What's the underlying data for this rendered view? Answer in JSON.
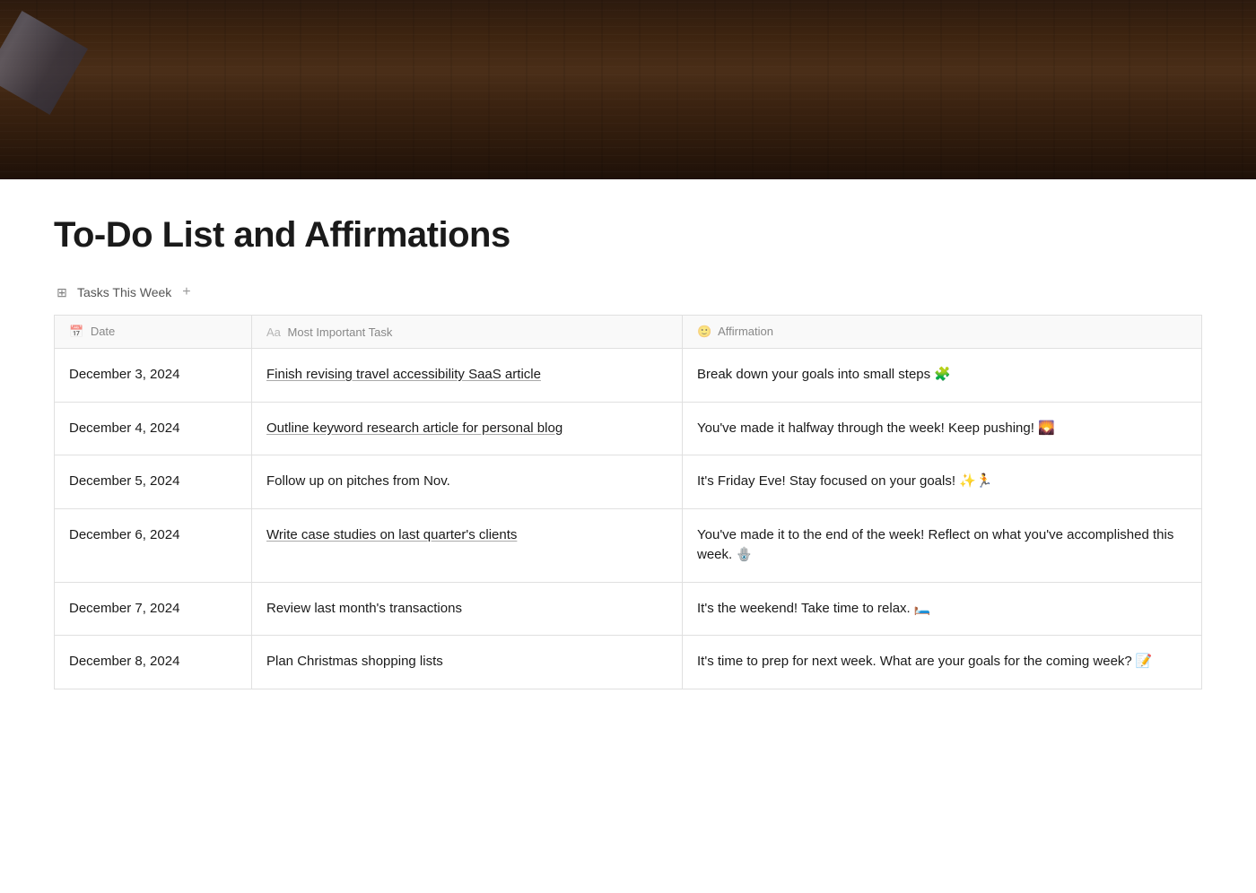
{
  "header": {
    "alt": "Wood texture background"
  },
  "page": {
    "title": "To-Do List and Affirmations"
  },
  "section": {
    "icon": "⊞",
    "label": "Tasks This Week",
    "add_label": "+"
  },
  "table": {
    "columns": [
      {
        "id": "date",
        "icon": "📅",
        "label": "Date"
      },
      {
        "id": "task",
        "icon": "Aa",
        "label": "Most Important Task"
      },
      {
        "id": "affirmation",
        "icon": "🙂",
        "label": "Affirmation"
      }
    ],
    "rows": [
      {
        "date": "December 3, 2024",
        "task": "Finish revising travel accessibility SaaS article",
        "task_underline": true,
        "affirmation": "Break down your goals into small steps 🧩"
      },
      {
        "date": "December 4, 2024",
        "task": "Outline keyword research article for personal blog",
        "task_underline": true,
        "affirmation": "You've made it halfway through the week! Keep pushing! 🌄"
      },
      {
        "date": "December 5, 2024",
        "task": "Follow up on pitches from Nov.",
        "task_underline": false,
        "affirmation": "It's Friday Eve! Stay focused on your goals! ✨🏃"
      },
      {
        "date": "December 6, 2024",
        "task": "Write case studies on last quarter's clients",
        "task_underline": true,
        "affirmation": "You've made it to the end of the week! Reflect on what you've accomplished this week. 🪬"
      },
      {
        "date": "December 7, 2024",
        "task": "Review last month's transactions",
        "task_underline": false,
        "affirmation": "It's the weekend! Take time to relax. 🛏️"
      },
      {
        "date": "December 8, 2024",
        "task": "Plan Christmas shopping lists",
        "task_underline": false,
        "affirmation": "It's time to prep for next week. What are your goals for the coming week? 📝"
      }
    ]
  }
}
